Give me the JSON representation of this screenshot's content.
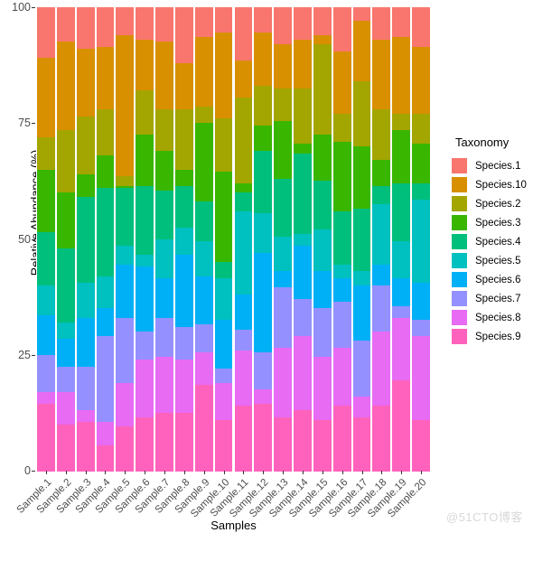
{
  "chart_data": {
    "type": "bar",
    "title": "",
    "subtitle": "",
    "stacked": true,
    "stack_mode": "percent",
    "xlabel": "Samples",
    "ylabel": "Relative Abundance (%)",
    "ylim": [
      0,
      100
    ],
    "yticks": [
      0,
      25,
      50,
      75,
      100
    ],
    "grid": false,
    "legend_title": "Taxonomy",
    "legend_position": "right",
    "categories": [
      "Sample.1",
      "Sample.2",
      "Sample.3",
      "Sample.4",
      "Sample.5",
      "Sample.6",
      "Sample.7",
      "Sample.8",
      "Sample.9",
      "Sample.10",
      "Sample.11",
      "Sample.12",
      "Sample.13",
      "Sample.14",
      "Sample.15",
      "Sample.16",
      "Sample.17",
      "Sample.18",
      "Sample.19",
      "Sample.20"
    ],
    "series": [
      {
        "name": "Species.1",
        "color": "#F8766D",
        "values": [
          11.0,
          7.5,
          9.0,
          8.5,
          6.0,
          7.0,
          7.5,
          12.0,
          6.5,
          5.5,
          11.5,
          5.5,
          8.0,
          7.0,
          6.0,
          9.5,
          3.0,
          7.0,
          6.5,
          8.5
        ]
      },
      {
        "name": "Species.10",
        "color": "#D89000",
        "values": [
          17.0,
          19.0,
          14.5,
          13.5,
          30.5,
          11.0,
          14.5,
          10.0,
          15.0,
          18.5,
          8.0,
          11.5,
          9.5,
          10.5,
          2.0,
          13.5,
          13.0,
          15.0,
          16.5,
          14.5
        ]
      },
      {
        "name": "Species.2",
        "color": "#A3A500",
        "values": [
          7.0,
          13.5,
          12.5,
          10.0,
          2.0,
          9.5,
          9.0,
          13.0,
          3.5,
          11.5,
          18.5,
          8.5,
          7.0,
          12.0,
          19.5,
          6.0,
          14.0,
          11.0,
          3.5,
          6.5
        ]
      },
      {
        "name": "Species.3",
        "color": "#39B600",
        "values": [
          13.5,
          12.0,
          5.0,
          7.0,
          0.5,
          11.0,
          8.5,
          3.5,
          17.0,
          19.5,
          2.0,
          5.5,
          12.5,
          2.0,
          10.0,
          15.0,
          13.5,
          5.5,
          11.5,
          8.5
        ]
      },
      {
        "name": "Species.4",
        "color": "#00BF7D",
        "values": [
          11.5,
          16.0,
          18.5,
          19.0,
          12.5,
          15.0,
          10.5,
          9.0,
          8.5,
          3.5,
          4.0,
          13.5,
          12.5,
          17.5,
          10.5,
          11.5,
          13.5,
          4.0,
          12.5,
          3.5
        ]
      },
      {
        "name": "Species.5",
        "color": "#00C0C0"
      },
      {
        "name": "Species.6",
        "color": "#00B0F6"
      },
      {
        "name": "Species.7",
        "color": "#9590FF"
      },
      {
        "name": "Species.8",
        "color": "#E76BF3"
      },
      {
        "name": "Species.9",
        "color": "#FF62BC"
      }
    ],
    "stacks": [
      {
        "sample": "Sample.1",
        "values": [
          11.0,
          17.0,
          7.0,
          13.5,
          11.5,
          6.5,
          8.5,
          8.0,
          2.5,
          14.5
        ]
      },
      {
        "sample": "Sample.2",
        "values": [
          7.5,
          19.0,
          13.5,
          12.0,
          16.0,
          3.5,
          6.0,
          5.5,
          7.0,
          10.0
        ]
      },
      {
        "sample": "Sample.3",
        "values": [
          9.0,
          14.5,
          12.5,
          5.0,
          18.5,
          7.5,
          10.5,
          9.5,
          2.5,
          10.5
        ]
      },
      {
        "sample": "Sample.4",
        "values": [
          8.5,
          13.5,
          10.0,
          7.0,
          19.0,
          7.0,
          6.0,
          18.5,
          5.0,
          5.5
        ]
      },
      {
        "sample": "Sample.5",
        "values": [
          6.0,
          30.5,
          2.0,
          0.5,
          12.5,
          4.0,
          11.5,
          14.0,
          9.5,
          9.5
        ]
      },
      {
        "sample": "Sample.6",
        "values": [
          7.0,
          11.0,
          9.5,
          11.0,
          15.0,
          2.5,
          14.0,
          6.0,
          12.5,
          11.5
        ]
      },
      {
        "sample": "Sample.7",
        "values": [
          7.5,
          14.5,
          9.0,
          8.5,
          10.5,
          8.5,
          8.5,
          8.5,
          12.0,
          12.5
        ]
      },
      {
        "sample": "Sample.8",
        "values": [
          12.0,
          10.0,
          13.0,
          3.5,
          9.0,
          6.0,
          15.5,
          7.0,
          11.5,
          12.5
        ]
      },
      {
        "sample": "Sample.9",
        "values": [
          6.5,
          15.0,
          3.5,
          17.0,
          8.5,
          7.5,
          10.5,
          6.0,
          7.0,
          18.5
        ]
      },
      {
        "sample": "Sample.10",
        "values": [
          5.5,
          18.5,
          11.5,
          19.5,
          3.5,
          9.0,
          10.5,
          3.0,
          8.0,
          11.0
        ]
      },
      {
        "sample": "Sample.11",
        "values": [
          11.5,
          8.0,
          18.5,
          2.0,
          4.0,
          18.0,
          7.5,
          4.5,
          12.0,
          14.0
        ]
      },
      {
        "sample": "Sample.12",
        "values": [
          5.5,
          11.5,
          8.5,
          5.5,
          13.5,
          8.5,
          21.5,
          8.0,
          3.0,
          14.5
        ]
      },
      {
        "sample": "Sample.13",
        "values": [
          8.0,
          9.5,
          7.0,
          12.5,
          12.5,
          7.5,
          3.5,
          13.0,
          15.0,
          11.5
        ]
      },
      {
        "sample": "Sample.14",
        "values": [
          7.0,
          10.5,
          12.0,
          2.0,
          17.5,
          2.5,
          11.5,
          8.0,
          16.0,
          13.0
        ]
      },
      {
        "sample": "Sample.15",
        "values": [
          6.0,
          2.0,
          19.5,
          10.0,
          10.5,
          9.0,
          8.0,
          10.5,
          13.5,
          11.0
        ]
      },
      {
        "sample": "Sample.16",
        "values": [
          9.5,
          13.5,
          6.0,
          15.0,
          11.5,
          3.0,
          5.0,
          10.0,
          12.5,
          14.0
        ]
      },
      {
        "sample": "Sample.17",
        "values": [
          3.0,
          13.0,
          14.0,
          13.5,
          13.5,
          3.0,
          12.0,
          12.0,
          4.5,
          11.5
        ]
      },
      {
        "sample": "Sample.18",
        "values": [
          7.0,
          15.0,
          11.0,
          5.5,
          4.0,
          13.0,
          4.5,
          10.0,
          16.0,
          14.0
        ]
      },
      {
        "sample": "Sample.19",
        "values": [
          6.5,
          16.5,
          3.5,
          11.5,
          12.5,
          8.0,
          6.0,
          2.5,
          13.5,
          19.5
        ]
      },
      {
        "sample": "Sample.20",
        "values": [
          8.5,
          14.5,
          6.5,
          8.5,
          3.5,
          18.0,
          8.0,
          3.5,
          18.0,
          11.0
        ]
      }
    ]
  },
  "axes": {
    "y_title": "Relative Abundance (%)",
    "x_title": "Samples",
    "y_ticks": [
      "100",
      "75",
      "50",
      "25",
      "0"
    ]
  },
  "legend": {
    "title": "Taxonomy",
    "items": [
      {
        "label": "Species.1",
        "color": "#F8766D"
      },
      {
        "label": "Species.10",
        "color": "#D89000"
      },
      {
        "label": "Species.2",
        "color": "#A3A500"
      },
      {
        "label": "Species.3",
        "color": "#39B600"
      },
      {
        "label": "Species.4",
        "color": "#00BF7D"
      },
      {
        "label": "Species.5",
        "color": "#00C0C0"
      },
      {
        "label": "Species.6",
        "color": "#00B0F6"
      },
      {
        "label": "Species.7",
        "color": "#9590FF"
      },
      {
        "label": "Species.8",
        "color": "#E76BF3"
      },
      {
        "label": "Species.9",
        "color": "#FF62BC"
      }
    ]
  },
  "watermark": {
    "text": "@51CTO博客"
  }
}
